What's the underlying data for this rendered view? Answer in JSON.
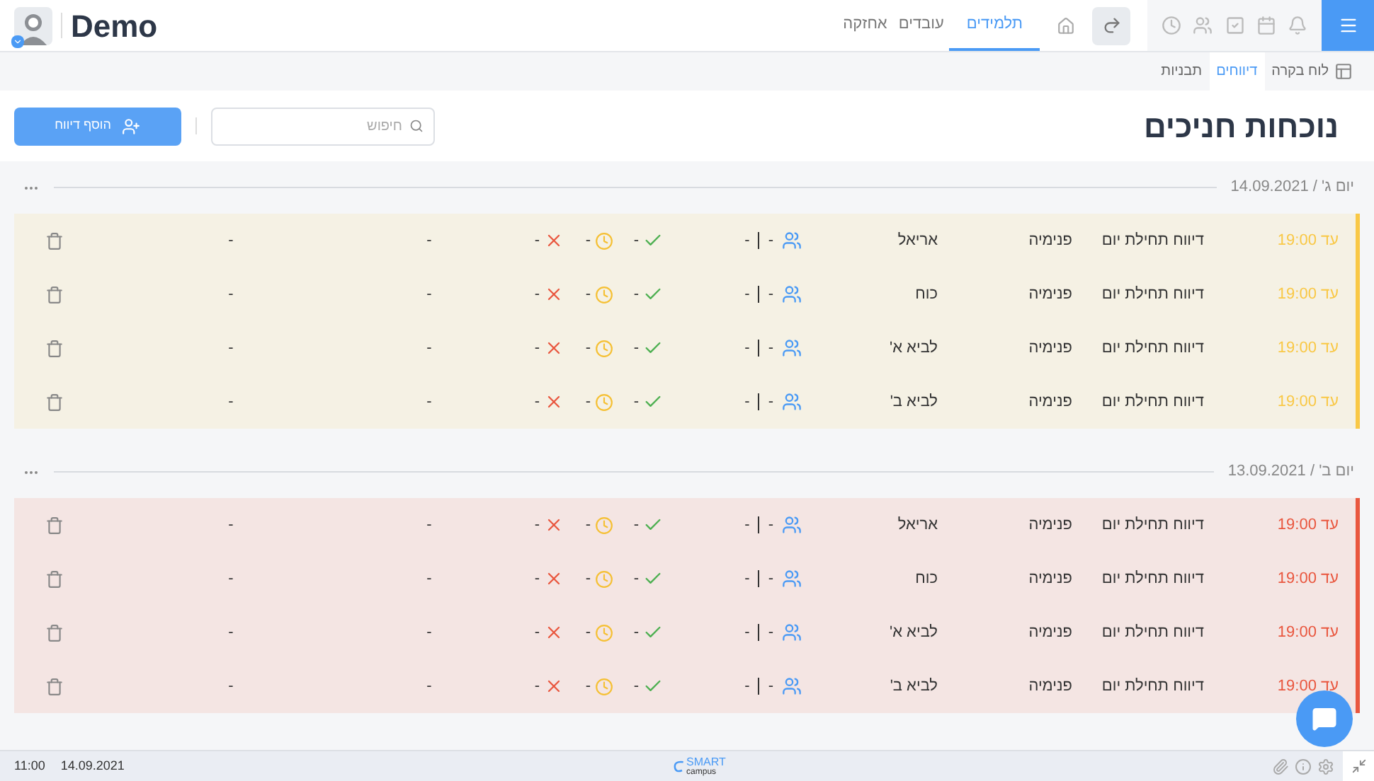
{
  "header": {
    "title": "Demo",
    "tabs": [
      {
        "label": "תלמידים",
        "selected": true
      },
      {
        "label": "עובדים",
        "selected": false
      },
      {
        "label": "אחזקה",
        "selected": false
      }
    ]
  },
  "subtabs": [
    {
      "label": "לוח בקרה",
      "selected": false,
      "kind": "dashboard"
    },
    {
      "label": "דיווחים",
      "selected": true,
      "kind": "plain"
    },
    {
      "label": "תבניות",
      "selected": false,
      "kind": "plain"
    }
  ],
  "page": {
    "title": "נוכחות חניכים",
    "search": {
      "placeholder": "חיפוש"
    },
    "add_button": "הוסף דיווח"
  },
  "groups": [
    {
      "date": "יום ג' / 14.09.2021",
      "color": "#f9c846",
      "rows": [
        {
          "deadline": "עד 19:00",
          "report": "דיווח תחילת יום",
          "type": "פנימיה",
          "group": "אריאל",
          "assigned": "-",
          "total": "-",
          "present": "-",
          "late": "-",
          "absent": "-",
          "column_9": "-",
          "column_10": "-"
        },
        {
          "deadline": "עד 19:00",
          "report": "דיווח תחילת יום",
          "type": "פנימיה",
          "group": "כוח",
          "assigned": "-",
          "total": "-",
          "present": "-",
          "late": "-",
          "absent": "-",
          "column_9": "-",
          "column_10": "-"
        },
        {
          "deadline": "עד 19:00",
          "report": "דיווח תחילת יום",
          "type": "פנימיה",
          "group": "לביא א'",
          "assigned": "-",
          "total": "-",
          "present": "-",
          "late": "-",
          "absent": "-",
          "column_9": "-",
          "column_10": "-"
        },
        {
          "deadline": "עד 19:00",
          "report": "דיווח תחילת יום",
          "type": "פנימיה",
          "group": "לביא ב'",
          "assigned": "-",
          "total": "-",
          "present": "-",
          "late": "-",
          "absent": "-",
          "column_9": "-",
          "column_10": "-"
        }
      ]
    },
    {
      "date": "יום ב' / 13.09.2021",
      "color": "#e9573f",
      "rows": [
        {
          "deadline": "עד 19:00",
          "report": "דיווח תחילת יום",
          "type": "פנימיה",
          "group": "אריאל",
          "assigned": "-",
          "total": "-",
          "present": "-",
          "late": "-",
          "absent": "-",
          "column_9": "-",
          "column_10": "-"
        },
        {
          "deadline": "עד 19:00",
          "report": "דיווח תחילת יום",
          "type": "פנימיה",
          "group": "כוח",
          "assigned": "-",
          "total": "-",
          "present": "-",
          "late": "-",
          "absent": "-",
          "column_9": "-",
          "column_10": "-"
        },
        {
          "deadline": "עד 19:00",
          "report": "דיווח תחילת יום",
          "type": "פנימיה",
          "group": "לביא א'",
          "assigned": "-",
          "total": "-",
          "present": "-",
          "late": "-",
          "absent": "-",
          "column_9": "-",
          "column_10": "-"
        },
        {
          "deadline": "עד 19:00",
          "report": "דיווח תחילת יום",
          "type": "פנימיה",
          "group": "לביא ב'",
          "assigned": "-",
          "total": "-",
          "present": "-",
          "late": "-",
          "absent": "-",
          "column_9": "-",
          "column_10": "-"
        }
      ]
    }
  ],
  "status_bar": {
    "time": "11:00",
    "date": "14.09.2021",
    "logo_top": "SMART",
    "logo_bottom": "campus"
  }
}
